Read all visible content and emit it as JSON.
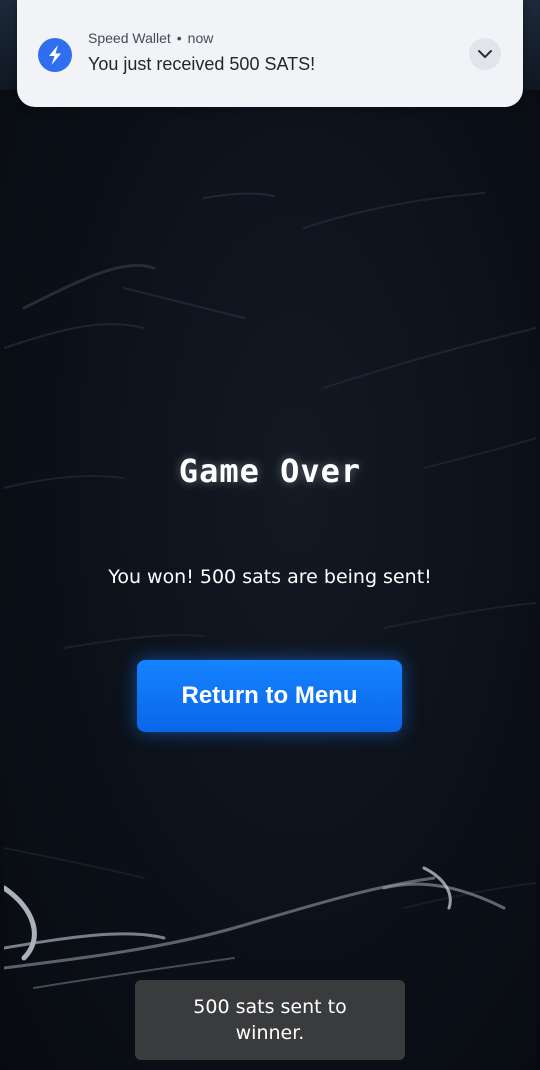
{
  "notification": {
    "app_name": "Speed Wallet",
    "separator": "•",
    "time": "now",
    "message": "You just received 500 SATS!",
    "icon": "speed-wallet-bolt-icon",
    "expand_icon": "chevron-down-icon"
  },
  "game": {
    "title": "Game Over",
    "result_message": "You won! 500 sats are being sent!",
    "return_button_label": "Return to Menu"
  },
  "toast": {
    "message": "500 sats sent to winner."
  },
  "colors": {
    "background": "#0b0f16",
    "notification_background": "#f1f3f7",
    "wallet_icon_blue": "#2f6ef0",
    "button_blue": "#0a6ff0",
    "toast_background": "#3a3b3d",
    "text_white": "#ffffff"
  }
}
